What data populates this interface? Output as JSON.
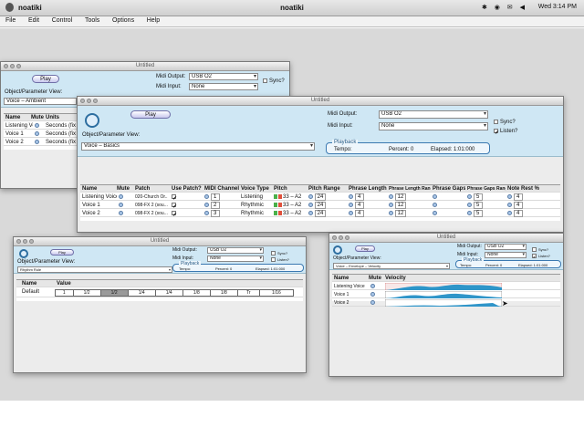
{
  "os": {
    "app_name": "noatiki",
    "window_title": "noatiki",
    "clock": "Wed 3:14 PM",
    "status_icons": "✱ ◉ ✉ ◀"
  },
  "menu": [
    "File",
    "Edit",
    "Control",
    "Tools",
    "Options",
    "Help"
  ],
  "win1": {
    "title": "Untitled",
    "play": "Play",
    "midi_output_label": "Midi Output:",
    "midi_output": "USB O2",
    "midi_input_label": "Midi Input:",
    "midi_input": "None",
    "sync": "Sync?",
    "view_label": "Object/Parameter View:",
    "view_value": "Voice – Ambient",
    "headers": [
      "Name",
      "Mute",
      "Units"
    ],
    "rows": [
      [
        "Listening Voice",
        "",
        "Seconds (fix"
      ],
      [
        "Voice 1",
        "",
        "Seconds (fix"
      ],
      [
        "Voice 2",
        "",
        "Seconds (fix"
      ]
    ]
  },
  "win2": {
    "title": "Untitled",
    "play": "Play",
    "midi_output_label": "Midi Output:",
    "midi_output": "USB O2",
    "midi_input_label": "Midi Input:",
    "midi_input": "None",
    "sync": "Sync?",
    "listen": "Listen?",
    "view_label": "Object/Parameter View:",
    "view_value": "Voice – Basics",
    "playback": {
      "legend": "Playback",
      "tempo": "Tempo:",
      "percent": "Percent: 0",
      "elapsed": "Elapsed: 1:01:000"
    },
    "headers": [
      "Name",
      "Mute",
      "Patch",
      "Use Patch?",
      "MIDI Channel",
      "Voice Type",
      "Pitch",
      "Pitch Range",
      "Phrase Length",
      "Phrase Length Range",
      "Phrase Gaps",
      "Phrase Gaps Range",
      "Note Rest %"
    ],
    "rows": [
      {
        "name": "Listening Voice",
        "patch": "020-Church Or...",
        "channel": "1",
        "type": "Listening",
        "pitch": "33 – A2",
        "range": "24",
        "plen": "4",
        "plrange": "12",
        "gaps": "5",
        "gaprange": "4"
      },
      {
        "name": "Voice 1",
        "patch": "098-FX 2 (sou...",
        "channel": "2",
        "type": "Rhythmic",
        "pitch": "33 – A2",
        "range": "24",
        "plen": "4",
        "plrange": "12",
        "gaps": "5",
        "gaprange": "4"
      },
      {
        "name": "Voice 2",
        "patch": "098-FX 2 (sou...",
        "channel": "3",
        "type": "Rhythmic",
        "pitch": "33 – A2",
        "range": "24",
        "plen": "4",
        "plrange": "12",
        "gaps": "5",
        "gaprange": "4"
      }
    ]
  },
  "win3": {
    "title": "Untitled",
    "play": "Play",
    "midi_output_label": "Midi Output:",
    "midi_output": "USB O2",
    "midi_input_label": "Midi Input:",
    "midi_input": "None",
    "sync": "Sync?",
    "listen": "Listen?",
    "view_label": "Object/Parameter View:",
    "view_value": "Rhythm Rule",
    "playback": {
      "legend": "Playback",
      "tempo": "Tempo:",
      "percent": "Percent: 0",
      "elapsed": "Elapsed: 1:01:000"
    },
    "headers": [
      "Name",
      "Value"
    ],
    "row_name": "Default",
    "rhythm": [
      "1",
      "1/2",
      "1/2",
      "1/4",
      "1/4",
      "1/8",
      "1/8",
      "Tr",
      "1/16"
    ],
    "selected_index": 2
  },
  "win4": {
    "title": "Untitled",
    "play": "Play",
    "midi_output_label": "Midi Output:",
    "midi_output": "USB O2",
    "midi_input_label": "Midi Input:",
    "midi_input": "None",
    "sync": "Sync?",
    "listen": "Listen?",
    "view_label": "Object/Parameter View:",
    "view_value": "Voice – Envelope – Velocity",
    "playback": {
      "legend": "Playback",
      "tempo": "Tempo:",
      "percent": "Percent: 0",
      "elapsed": "Elapsed: 1:01:000"
    },
    "headers": [
      "Name",
      "Mute",
      "Velocity"
    ],
    "rows": [
      "Listening Voice",
      "Voice 1",
      "Voice 2"
    ],
    "envelope_color": "#2f95c9"
  }
}
